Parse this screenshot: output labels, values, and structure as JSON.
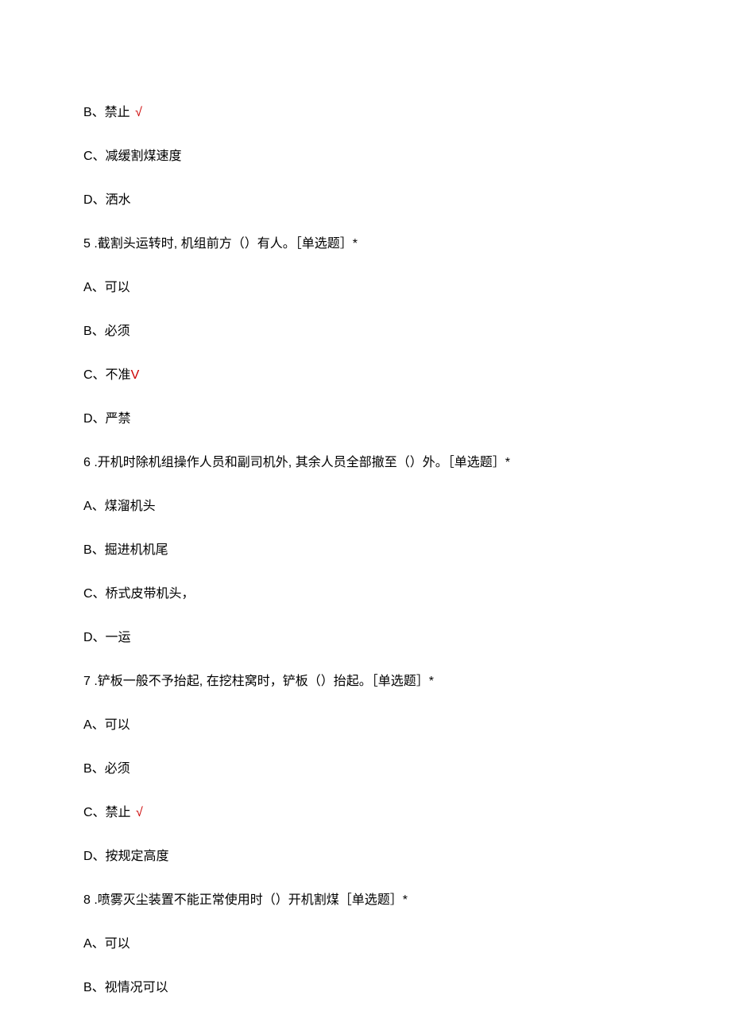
{
  "q4_option_b": "B、禁止",
  "q4_option_b_mark": " √",
  "q4_option_c": "C、减缓割煤速度",
  "q4_option_d": "D、洒水",
  "q5_num": "5",
  "q5_text": "  .截割头运转时, 机组前方（）有人。［单选题］*",
  "q5_option_a": "A、可以",
  "q5_option_b": "B、必须",
  "q5_option_c": "C、不准",
  "q5_option_c_mark": "V",
  "q5_option_d": "D、严禁",
  "q6_num": "6",
  "q6_text": "  .开机时除机组操作人员和副司机外, 其余人员全部撤至（）外。［单选题］*",
  "q6_option_a": "A、煤溜机头",
  "q6_option_b": "B、掘进机机尾",
  "q6_option_c": "C、桥式皮带机头，",
  "q6_option_d": "D、一运",
  "q7_num": "7",
  "q7_text": "  .铲板一般不予抬起, 在挖柱窝时，铲板（）抬起。［单选题］*",
  "q7_option_a": "A、可以",
  "q7_option_b": "B、必须",
  "q7_option_c": "C、禁止",
  "q7_option_c_mark": " √",
  "q7_option_d": "D、按规定高度",
  "q8_num": "8",
  "q8_text": "  .喷雾灭尘装置不能正常使用时（）开机割煤［单选题］*",
  "q8_option_a": "A、可以",
  "q8_option_b": "B、视情况可以"
}
